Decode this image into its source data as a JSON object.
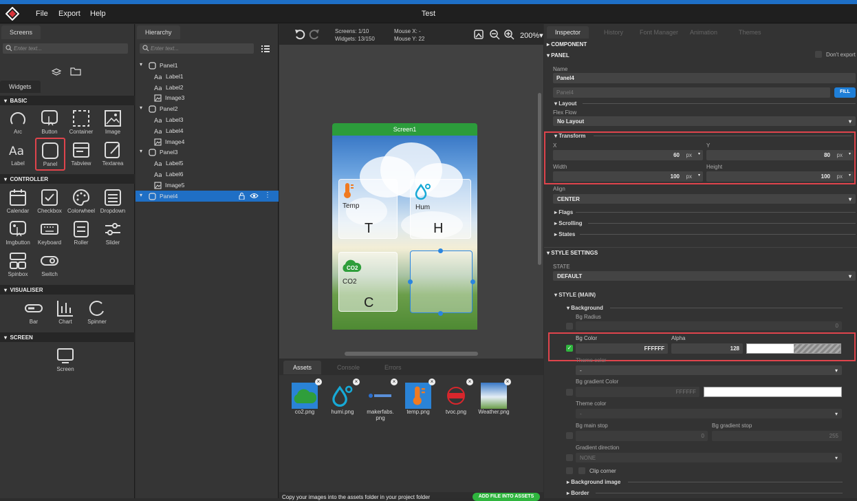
{
  "app": {
    "title": "Test"
  },
  "menu": [
    "File",
    "Export",
    "Help"
  ],
  "left": {
    "tabs": {
      "screens": "Screens",
      "widgets": "Widgets"
    },
    "search_placeholder": "Enter text...",
    "sections": {
      "basic": "BASIC",
      "controller": "CONTROLLER",
      "visualiser": "VISUALISER",
      "screen": "SCREEN"
    },
    "basic": [
      "Arc",
      "Button",
      "Container",
      "Image",
      "Label",
      "Panel",
      "Tabview",
      "Textarea"
    ],
    "controller": [
      "Calendar",
      "Checkbox",
      "Colorwheel",
      "Dropdown",
      "Imgbutton",
      "Keyboard",
      "Roller",
      "Slider",
      "Spinbox",
      "Switch"
    ],
    "visualiser": [
      "Bar",
      "Chart",
      "Spinner"
    ],
    "screen": [
      "Screen"
    ]
  },
  "hierarchy": {
    "tab": "Hierarchy",
    "search_placeholder": "Enter text...",
    "rows": [
      {
        "label": "Panel1",
        "type": "panel"
      },
      {
        "label": "Label1",
        "type": "label"
      },
      {
        "label": "Label2",
        "type": "label"
      },
      {
        "label": "Image3",
        "type": "image"
      },
      {
        "label": "Panel2",
        "type": "panel"
      },
      {
        "label": "Label3",
        "type": "label"
      },
      {
        "label": "Label4",
        "type": "label"
      },
      {
        "label": "Image4",
        "type": "image"
      },
      {
        "label": "Panel3",
        "type": "panel"
      },
      {
        "label": "Label5",
        "type": "label"
      },
      {
        "label": "Label6",
        "type": "label"
      },
      {
        "label": "Image5",
        "type": "image"
      },
      {
        "label": "Panel4",
        "type": "panel"
      }
    ]
  },
  "center": {
    "screens_label": "Screens:",
    "screens_value": "1/10",
    "widgets_label": "Widgets:",
    "widgets_value": "13/150",
    "mousex_label": "Mouse X:",
    "mousex_value": "-",
    "mousey_label": "Mouse Y:",
    "mousey_value": "22",
    "zoom": "200%",
    "screen_name": "Screen1",
    "panels": {
      "temp_label": "Temp",
      "temp_value": "T",
      "hum_label": "Hum",
      "hum_value": "H",
      "co2_label": "CO2",
      "co2_value": "C"
    }
  },
  "bottom": {
    "tabs": [
      "Assets",
      "Console",
      "Errors"
    ],
    "assets": [
      "co2.png",
      "humi.png",
      "makerfabs.png",
      "temp.png",
      "tvoc.png",
      "Weather.png"
    ],
    "hint": "Copy your images into the assets folder in your project folder",
    "add_button": "ADD FILE INTO ASSETS"
  },
  "inspector": {
    "tabs": [
      "Inspector",
      "History",
      "Font Manager",
      "Animation",
      "Themes"
    ],
    "component": "COMPONENT",
    "panel": "PANEL",
    "dont_export": "Don't export",
    "name_label": "Name",
    "name_value": "Panel4",
    "name_placeholder": "Panel4",
    "fill": "FILL",
    "layout": "Layout",
    "flex_flow": "Flex Flow",
    "flex_value": "No Layout",
    "transform": "Transform",
    "x_label": "X",
    "x_value": "60",
    "y_label": "Y",
    "y_value": "80",
    "width_label": "Width",
    "width_value": "100",
    "height_label": "Height",
    "height_value": "100",
    "unit": "px",
    "align_label": "Align",
    "align_value": "CENTER",
    "flags": "Flags",
    "scrolling": "Scrolling",
    "states": "States",
    "style_settings": "STYLE SETTINGS",
    "state_label": "STATE",
    "state_value": "DEFAULT",
    "style_main": "STYLE (MAIN)",
    "background": "Background",
    "bg_radius": "Bg Radius",
    "bg_radius_value": "0",
    "bg_color": "Bg Color",
    "bg_color_value": "FFFFFF",
    "alpha": "Alpha",
    "alpha_value": "128",
    "theme_color": "Theme color",
    "theme_value": "-",
    "bg_gradient": "Bg gradient Color",
    "bg_gradient_value": "FFFFFF",
    "theme_color2": "Theme color",
    "theme_value2": "-",
    "bg_main_stop": "Bg main stop",
    "bg_main_stop_value": "0",
    "bg_grad_stop": "Bg gradient stop",
    "bg_grad_stop_value": "255",
    "grad_dir": "Gradient direction",
    "grad_dir_value": "NONE",
    "clip_corner": "Clip corner",
    "bg_image": "Background image",
    "border": "Border"
  },
  "colors": {
    "accent": "#1f6fc5",
    "highlight": "#e0444c",
    "screen_header": "#2c9c3b",
    "add_button": "#2fb53e"
  }
}
